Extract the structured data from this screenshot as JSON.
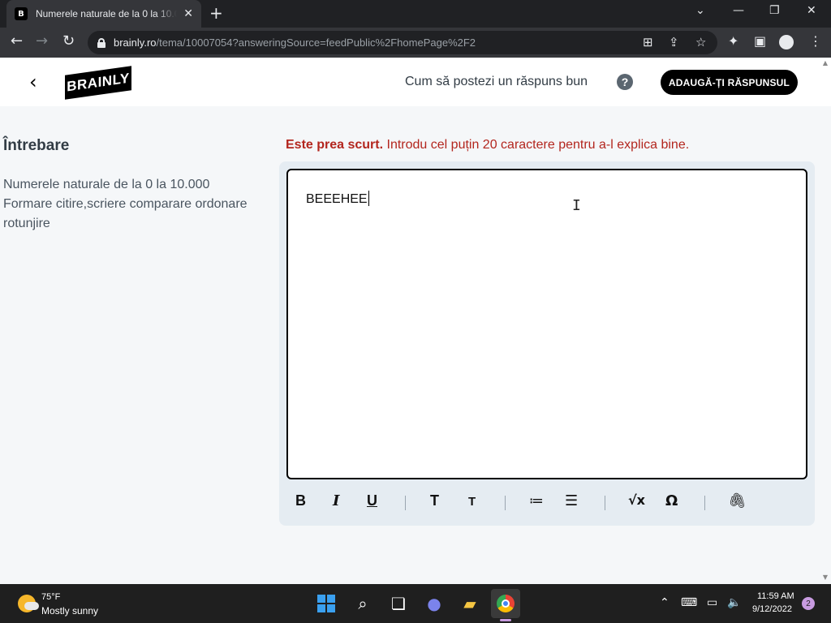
{
  "browser": {
    "tab_title": "Numerele naturale de la 0 la 10.000",
    "tab_favicon": "B",
    "url_host": "brainly.ro",
    "url_path": "/tema/10007054?answeringSource=feedPublic%2FhomePage%2F2"
  },
  "header": {
    "logo": "BRAINLY",
    "howto_link": "Cum să postezi un răspuns bun",
    "help_icon": "?",
    "add_answer_button": "ADAUGĂ-ȚI RĂSPUNSUL"
  },
  "question": {
    "heading": "Întrebare",
    "text": "Numerele naturale de la 0 la 10.000 Formare citire,scriere comparare ordonare rotunjire"
  },
  "answer": {
    "warning_bold": "Este prea scurt.",
    "warning_text": " Introdu cel puțin 20 caractere pentru a-l explica bine.",
    "editor_value": "BEEEHEE"
  },
  "formatting_toolbar": {
    "bold": "B",
    "italic": "I",
    "underline": "U",
    "heading_large": "T",
    "heading_small": "T",
    "ordered_list": "≔",
    "bullet_list": "☰",
    "math": "√x",
    "symbol": "Ω",
    "attach": "🖇"
  },
  "taskbar": {
    "weather_temp": "75°F",
    "weather_condition": "Mostly sunny",
    "time": "11:59 AM",
    "date": "9/12/2022",
    "notification_count": "2"
  }
}
